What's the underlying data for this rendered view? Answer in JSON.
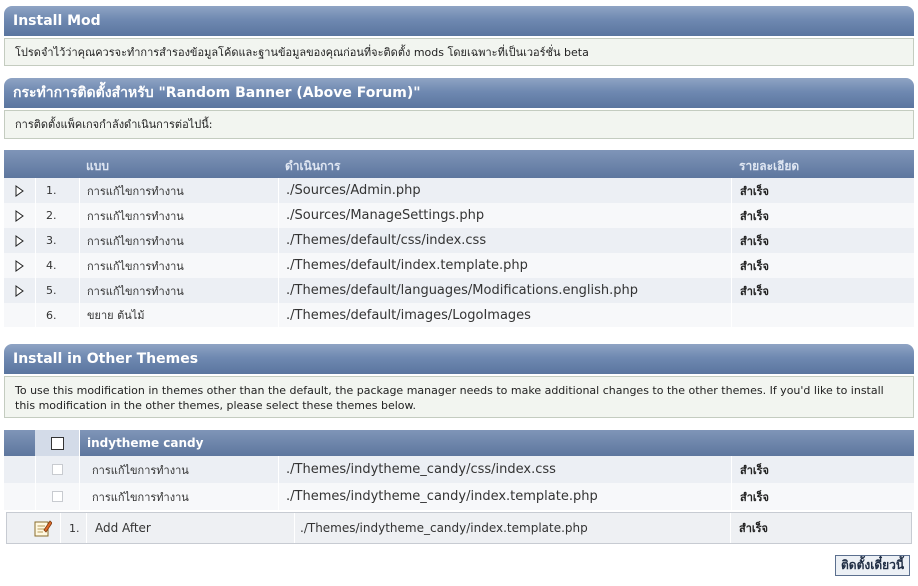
{
  "install_mod": {
    "title": "Install Mod",
    "notice": "โปรดจำไว้ว่าคุณควรจะทำการสำรองข้อมูลโค้ดและฐานข้อมูลของคุณก่อนที่จะติดตั้ง mods โดยเฉพาะที่เป็นเวอร์ชั่น beta"
  },
  "actions": {
    "title": "กระทำการติดตั้งสำหรับ \"Random Banner (Above Forum)\"",
    "notice": "การติดตั้งแพ็คเกจกำลังดำเนินการต่อไปนี้:",
    "columns": {
      "type": "แบบ",
      "action": "ดำเนินการ",
      "details": "รายละเอียด"
    },
    "rows": [
      {
        "num": "1.",
        "type": "การแก้ไขการทำงาน",
        "path": "./Sources/Admin.php",
        "status": "สำเร็จ"
      },
      {
        "num": "2.",
        "type": "การแก้ไขการทำงาน",
        "path": "./Sources/ManageSettings.php",
        "status": "สำเร็จ"
      },
      {
        "num": "3.",
        "type": "การแก้ไขการทำงาน",
        "path": "./Themes/default/css/index.css",
        "status": "สำเร็จ"
      },
      {
        "num": "4.",
        "type": "การแก้ไขการทำงาน",
        "path": "./Themes/default/index.template.php",
        "status": "สำเร็จ"
      },
      {
        "num": "5.",
        "type": "การแก้ไขการทำงาน",
        "path": "./Themes/default/languages/Modifications.english.php",
        "status": "สำเร็จ"
      },
      {
        "num": "6.",
        "type": "ขยาย ต้นไม้",
        "path": "./Themes/default/images/LogoImages",
        "status": ""
      }
    ]
  },
  "other_themes": {
    "title": "Install in Other Themes",
    "notice": "To use this modification in themes other than the default, the package manager needs to make additional changes to the other themes. If you'd like to install this modification in the other themes, please select these themes below.",
    "theme_name": "indytheme candy",
    "rows": [
      {
        "type": "การแก้ไขการทำงาน",
        "path": "./Themes/indytheme_candy/css/index.css",
        "status": "สำเร็จ"
      },
      {
        "type": "การแก้ไขการทำงาน",
        "path": "./Themes/indytheme_candy/index.template.php",
        "status": "สำเร็จ"
      }
    ],
    "sub_row": {
      "num": "1.",
      "type": "Add After",
      "path": "./Themes/indytheme_candy/index.template.php",
      "status": "สำเร็จ"
    }
  },
  "install_button": "ติดตั้งเดี๋ยวนี้"
}
